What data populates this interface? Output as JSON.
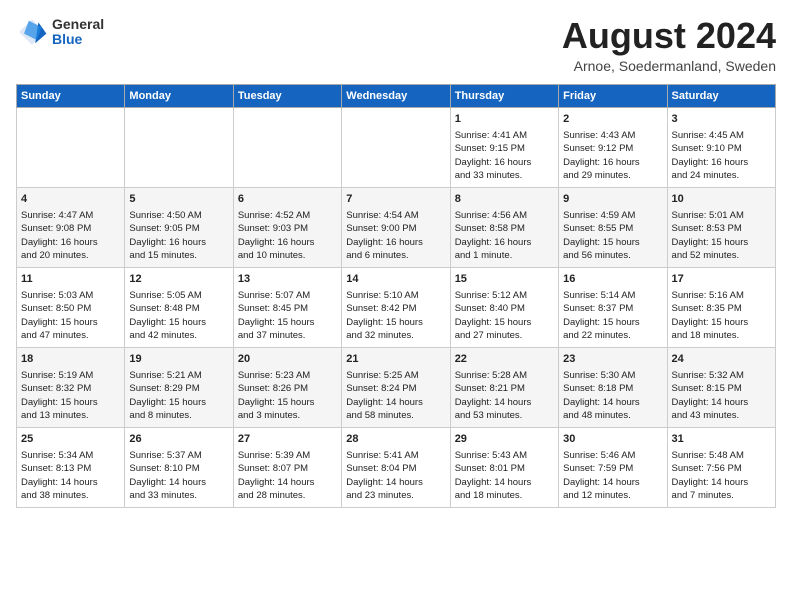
{
  "header": {
    "logo_general": "General",
    "logo_blue": "Blue",
    "month_year": "August 2024",
    "location": "Arnoe, Soedermanland, Sweden"
  },
  "weekdays": [
    "Sunday",
    "Monday",
    "Tuesday",
    "Wednesday",
    "Thursday",
    "Friday",
    "Saturday"
  ],
  "weeks": [
    [
      {
        "day": "",
        "lines": []
      },
      {
        "day": "",
        "lines": []
      },
      {
        "day": "",
        "lines": []
      },
      {
        "day": "",
        "lines": []
      },
      {
        "day": "1",
        "lines": [
          "Sunrise: 4:41 AM",
          "Sunset: 9:15 PM",
          "Daylight: 16 hours",
          "and 33 minutes."
        ]
      },
      {
        "day": "2",
        "lines": [
          "Sunrise: 4:43 AM",
          "Sunset: 9:12 PM",
          "Daylight: 16 hours",
          "and 29 minutes."
        ]
      },
      {
        "day": "3",
        "lines": [
          "Sunrise: 4:45 AM",
          "Sunset: 9:10 PM",
          "Daylight: 16 hours",
          "and 24 minutes."
        ]
      }
    ],
    [
      {
        "day": "4",
        "lines": [
          "Sunrise: 4:47 AM",
          "Sunset: 9:08 PM",
          "Daylight: 16 hours",
          "and 20 minutes."
        ]
      },
      {
        "day": "5",
        "lines": [
          "Sunrise: 4:50 AM",
          "Sunset: 9:05 PM",
          "Daylight: 16 hours",
          "and 15 minutes."
        ]
      },
      {
        "day": "6",
        "lines": [
          "Sunrise: 4:52 AM",
          "Sunset: 9:03 PM",
          "Daylight: 16 hours",
          "and 10 minutes."
        ]
      },
      {
        "day": "7",
        "lines": [
          "Sunrise: 4:54 AM",
          "Sunset: 9:00 PM",
          "Daylight: 16 hours",
          "and 6 minutes."
        ]
      },
      {
        "day": "8",
        "lines": [
          "Sunrise: 4:56 AM",
          "Sunset: 8:58 PM",
          "Daylight: 16 hours",
          "and 1 minute."
        ]
      },
      {
        "day": "9",
        "lines": [
          "Sunrise: 4:59 AM",
          "Sunset: 8:55 PM",
          "Daylight: 15 hours",
          "and 56 minutes."
        ]
      },
      {
        "day": "10",
        "lines": [
          "Sunrise: 5:01 AM",
          "Sunset: 8:53 PM",
          "Daylight: 15 hours",
          "and 52 minutes."
        ]
      }
    ],
    [
      {
        "day": "11",
        "lines": [
          "Sunrise: 5:03 AM",
          "Sunset: 8:50 PM",
          "Daylight: 15 hours",
          "and 47 minutes."
        ]
      },
      {
        "day": "12",
        "lines": [
          "Sunrise: 5:05 AM",
          "Sunset: 8:48 PM",
          "Daylight: 15 hours",
          "and 42 minutes."
        ]
      },
      {
        "day": "13",
        "lines": [
          "Sunrise: 5:07 AM",
          "Sunset: 8:45 PM",
          "Daylight: 15 hours",
          "and 37 minutes."
        ]
      },
      {
        "day": "14",
        "lines": [
          "Sunrise: 5:10 AM",
          "Sunset: 8:42 PM",
          "Daylight: 15 hours",
          "and 32 minutes."
        ]
      },
      {
        "day": "15",
        "lines": [
          "Sunrise: 5:12 AM",
          "Sunset: 8:40 PM",
          "Daylight: 15 hours",
          "and 27 minutes."
        ]
      },
      {
        "day": "16",
        "lines": [
          "Sunrise: 5:14 AM",
          "Sunset: 8:37 PM",
          "Daylight: 15 hours",
          "and 22 minutes."
        ]
      },
      {
        "day": "17",
        "lines": [
          "Sunrise: 5:16 AM",
          "Sunset: 8:35 PM",
          "Daylight: 15 hours",
          "and 18 minutes."
        ]
      }
    ],
    [
      {
        "day": "18",
        "lines": [
          "Sunrise: 5:19 AM",
          "Sunset: 8:32 PM",
          "Daylight: 15 hours",
          "and 13 minutes."
        ]
      },
      {
        "day": "19",
        "lines": [
          "Sunrise: 5:21 AM",
          "Sunset: 8:29 PM",
          "Daylight: 15 hours",
          "and 8 minutes."
        ]
      },
      {
        "day": "20",
        "lines": [
          "Sunrise: 5:23 AM",
          "Sunset: 8:26 PM",
          "Daylight: 15 hours",
          "and 3 minutes."
        ]
      },
      {
        "day": "21",
        "lines": [
          "Sunrise: 5:25 AM",
          "Sunset: 8:24 PM",
          "Daylight: 14 hours",
          "and 58 minutes."
        ]
      },
      {
        "day": "22",
        "lines": [
          "Sunrise: 5:28 AM",
          "Sunset: 8:21 PM",
          "Daylight: 14 hours",
          "and 53 minutes."
        ]
      },
      {
        "day": "23",
        "lines": [
          "Sunrise: 5:30 AM",
          "Sunset: 8:18 PM",
          "Daylight: 14 hours",
          "and 48 minutes."
        ]
      },
      {
        "day": "24",
        "lines": [
          "Sunrise: 5:32 AM",
          "Sunset: 8:15 PM",
          "Daylight: 14 hours",
          "and 43 minutes."
        ]
      }
    ],
    [
      {
        "day": "25",
        "lines": [
          "Sunrise: 5:34 AM",
          "Sunset: 8:13 PM",
          "Daylight: 14 hours",
          "and 38 minutes."
        ]
      },
      {
        "day": "26",
        "lines": [
          "Sunrise: 5:37 AM",
          "Sunset: 8:10 PM",
          "Daylight: 14 hours",
          "and 33 minutes."
        ]
      },
      {
        "day": "27",
        "lines": [
          "Sunrise: 5:39 AM",
          "Sunset: 8:07 PM",
          "Daylight: 14 hours",
          "and 28 minutes."
        ]
      },
      {
        "day": "28",
        "lines": [
          "Sunrise: 5:41 AM",
          "Sunset: 8:04 PM",
          "Daylight: 14 hours",
          "and 23 minutes."
        ]
      },
      {
        "day": "29",
        "lines": [
          "Sunrise: 5:43 AM",
          "Sunset: 8:01 PM",
          "Daylight: 14 hours",
          "and 18 minutes."
        ]
      },
      {
        "day": "30",
        "lines": [
          "Sunrise: 5:46 AM",
          "Sunset: 7:59 PM",
          "Daylight: 14 hours",
          "and 12 minutes."
        ]
      },
      {
        "day": "31",
        "lines": [
          "Sunrise: 5:48 AM",
          "Sunset: 7:56 PM",
          "Daylight: 14 hours",
          "and 7 minutes."
        ]
      }
    ]
  ]
}
